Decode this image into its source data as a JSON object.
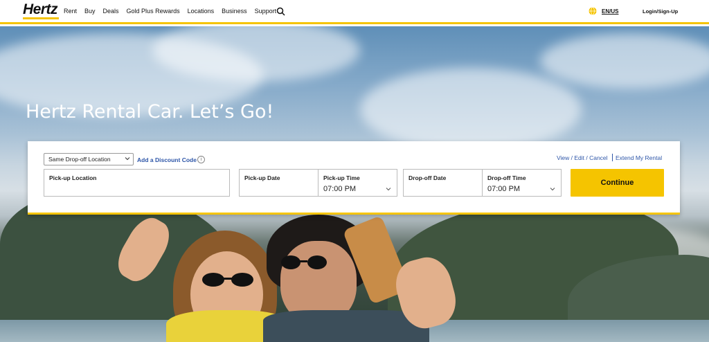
{
  "header": {
    "logo_text": "Hertz",
    "nav": [
      "Rent",
      "Buy",
      "Deals",
      "Gold Plus Rewards",
      "Locations",
      "Business",
      "Support"
    ],
    "language": "EN/US",
    "login": "Login/Sign-Up"
  },
  "hero": {
    "title": "Hertz Rental Car. Let’s Go!"
  },
  "booking": {
    "dropoff_select": "Same Drop-off Location",
    "discount_link": "Add a Discount Code",
    "info_glyph": "i",
    "view_edit_cancel": "View / Edit / Cancel",
    "extend_rental": "Extend My Rental",
    "pickup_location_label": "Pick-up Location",
    "pickup_date_label": "Pick-up Date",
    "pickup_time_label": "Pick-up Time",
    "pickup_time_value": "07:00 PM",
    "dropoff_date_label": "Drop-off Date",
    "dropoff_time_label": "Drop-off Time",
    "dropoff_time_value": "07:00 PM",
    "continue_label": "Continue"
  },
  "colors": {
    "brand_yellow": "#f5c400",
    "link_blue": "#2e56a8"
  }
}
